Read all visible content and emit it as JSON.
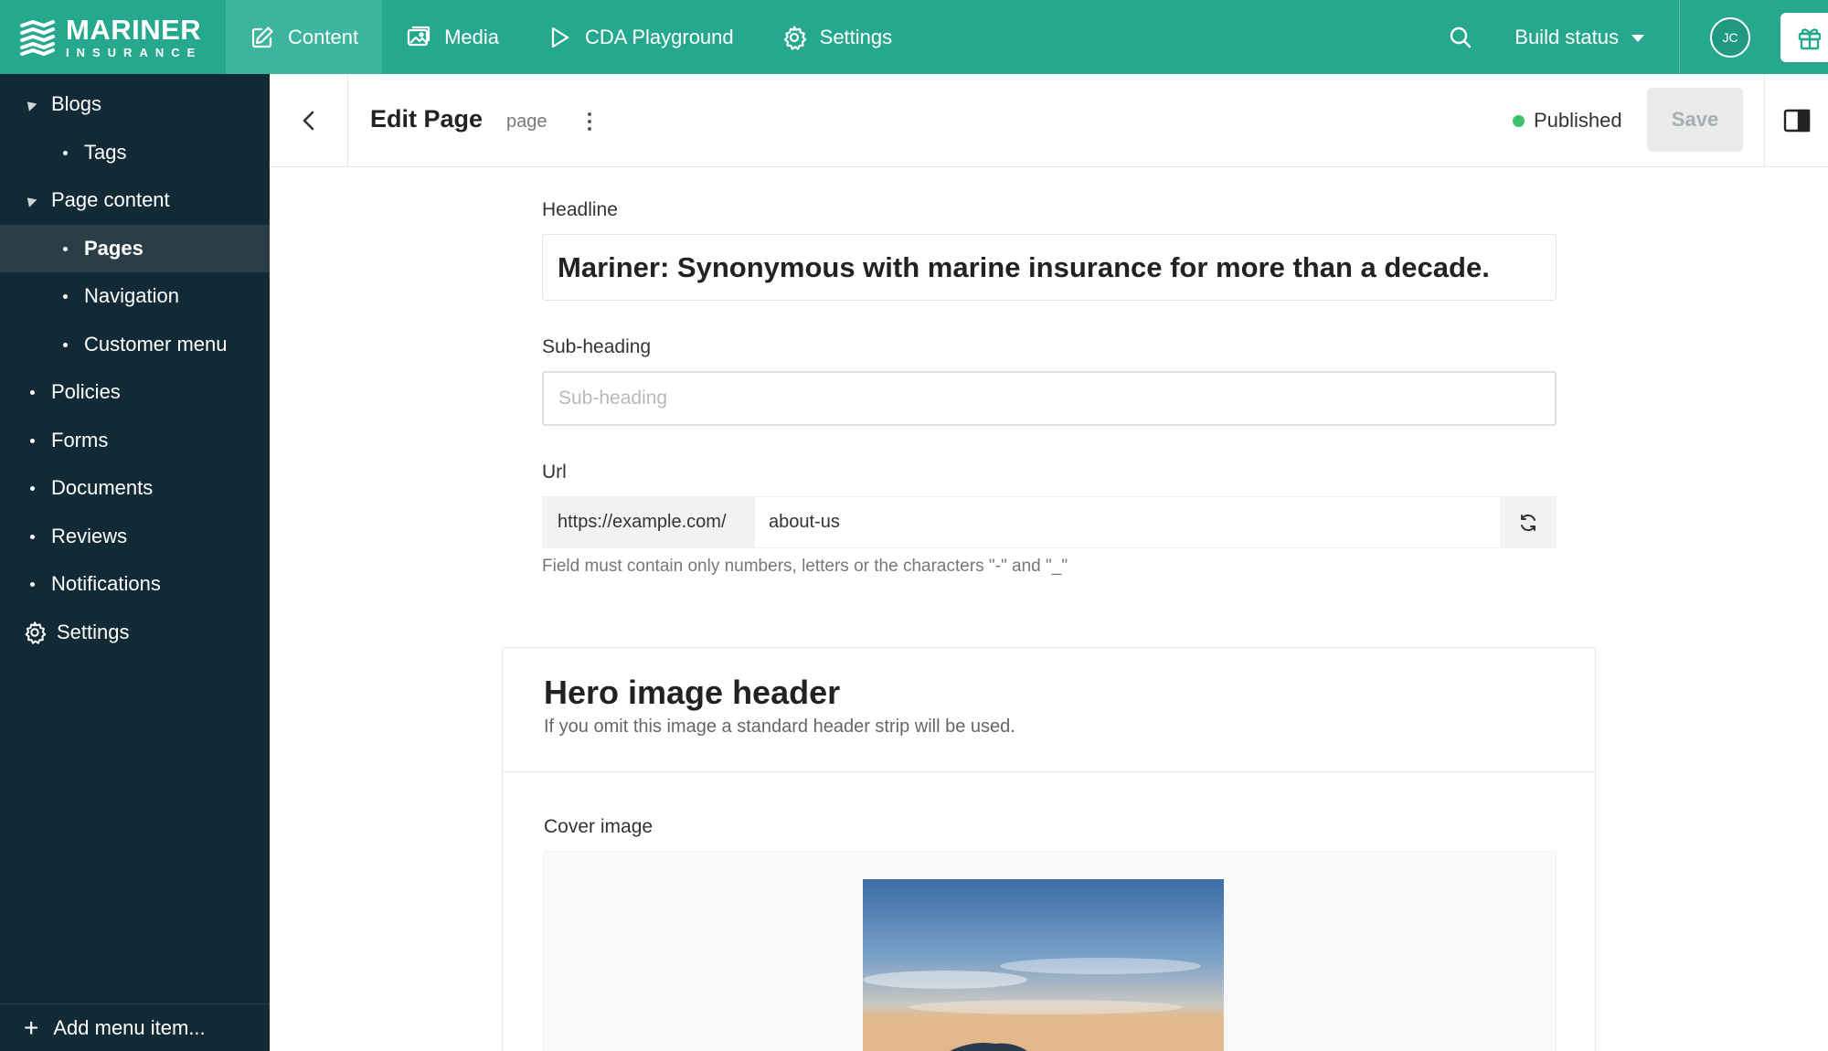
{
  "brand": {
    "name": "MARINER",
    "sub": "INSURANCE"
  },
  "topnav": {
    "tabs": [
      {
        "label": "Content",
        "icon": "edit-icon"
      },
      {
        "label": "Media",
        "icon": "image-icon"
      },
      {
        "label": "CDA Playground",
        "icon": "play-icon"
      },
      {
        "label": "Settings",
        "icon": "gear-icon"
      }
    ],
    "build_status": "Build status",
    "avatar_initials": "JC"
  },
  "sidebar": {
    "items": [
      {
        "label": "Blogs"
      },
      {
        "label": "Tags"
      },
      {
        "label": "Page content"
      },
      {
        "label": "Pages"
      },
      {
        "label": "Navigation"
      },
      {
        "label": "Customer menu"
      },
      {
        "label": "Policies"
      },
      {
        "label": "Forms"
      },
      {
        "label": "Documents"
      },
      {
        "label": "Reviews"
      },
      {
        "label": "Notifications"
      },
      {
        "label": "Settings"
      }
    ],
    "footer": "Add menu item..."
  },
  "editor": {
    "title": "Edit Page",
    "type": "page",
    "status": "Published",
    "save_label": "Save"
  },
  "fields": {
    "headline_label": "Headline",
    "headline_value": "Mariner: Synonymous with marine insurance for more than a decade.",
    "subheading_label": "Sub-heading",
    "subheading_placeholder": "Sub-heading",
    "url_label": "Url",
    "url_prefix": "https://example.com/",
    "url_value": "about-us",
    "url_help": "Field must contain only numbers, letters or the characters \"-\" and \"_\""
  },
  "hero": {
    "title": "Hero image header",
    "description": "If you omit this image a standard header strip will be used.",
    "cover_label": "Cover image"
  },
  "colors": {
    "topbar": "#26a88e",
    "sidebar": "#112a35",
    "published": "#3cc06c"
  }
}
